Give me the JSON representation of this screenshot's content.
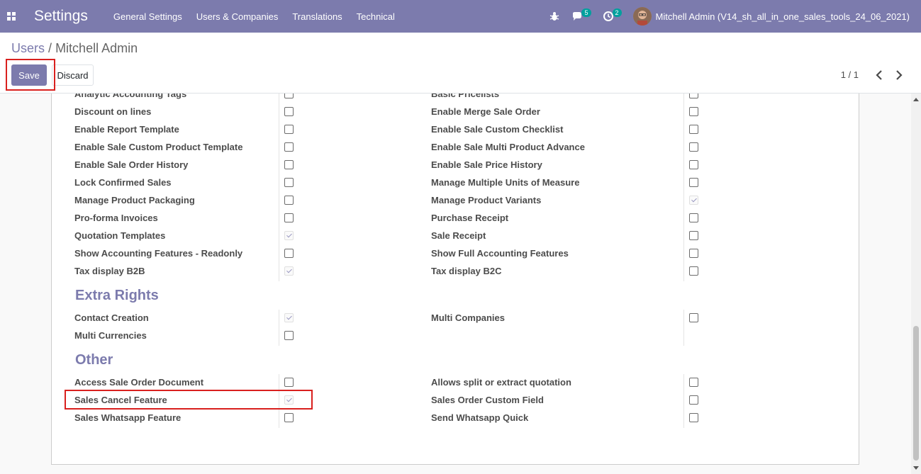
{
  "navbar": {
    "brand": "Settings",
    "menu": [
      "General Settings",
      "Users & Companies",
      "Translations",
      "Technical"
    ],
    "messages_count": "5",
    "activities_count": "2",
    "user": "Mitchell Admin (V14_sh_all_in_one_sales_tools_24_06_2021)"
  },
  "breadcrumb": {
    "parent": "Users",
    "separator": "/",
    "current": "Mitchell Admin"
  },
  "buttons": {
    "save": "Save",
    "discard": "Discard"
  },
  "pager": {
    "value": "1 / 1"
  },
  "sales_rights": {
    "left": [
      {
        "label": "Analytic Accounting Tags",
        "checked": false
      },
      {
        "label": "Discount on lines",
        "checked": false
      },
      {
        "label": "Enable Report Template",
        "checked": false
      },
      {
        "label": "Enable Sale Custom Product Template",
        "checked": false
      },
      {
        "label": "Enable Sale Order History",
        "checked": false
      },
      {
        "label": "Lock Confirmed Sales",
        "checked": false
      },
      {
        "label": "Manage Product Packaging",
        "checked": false
      },
      {
        "label": "Pro-forma Invoices",
        "checked": false
      },
      {
        "label": "Quotation Templates",
        "checked": true
      },
      {
        "label": "Show Accounting Features - Readonly",
        "checked": false
      },
      {
        "label": "Tax display B2B",
        "checked": true
      }
    ],
    "right": [
      {
        "label": "Basic Pricelists",
        "checked": false
      },
      {
        "label": "Enable Merge Sale Order",
        "checked": false
      },
      {
        "label": "Enable Sale Custom Checklist",
        "checked": false
      },
      {
        "label": "Enable Sale Multi Product Advance",
        "checked": false
      },
      {
        "label": "Enable Sale Price History",
        "checked": false
      },
      {
        "label": "Manage Multiple Units of Measure",
        "checked": false
      },
      {
        "label": "Manage Product Variants",
        "checked": true
      },
      {
        "label": "Purchase Receipt",
        "checked": false
      },
      {
        "label": "Sale Receipt",
        "checked": false
      },
      {
        "label": "Show Full Accounting Features",
        "checked": false
      },
      {
        "label": "Tax display B2C",
        "checked": false
      }
    ]
  },
  "extra_rights": {
    "title": "Extra Rights",
    "left": [
      {
        "label": "Contact Creation",
        "checked": true
      },
      {
        "label": "Multi Currencies",
        "checked": false
      }
    ],
    "right": [
      {
        "label": "Multi Companies",
        "checked": false
      }
    ]
  },
  "other": {
    "title": "Other",
    "left": [
      {
        "label": "Access Sale Order Document",
        "checked": false
      },
      {
        "label": "Sales Cancel Feature",
        "checked": true
      },
      {
        "label": "Sales Whatsapp Feature",
        "checked": false
      }
    ],
    "right": [
      {
        "label": "Allows split or extract quotation",
        "checked": false
      },
      {
        "label": "Sales Order Custom Field",
        "checked": false
      },
      {
        "label": "Send Whatsapp Quick",
        "checked": false
      }
    ]
  }
}
